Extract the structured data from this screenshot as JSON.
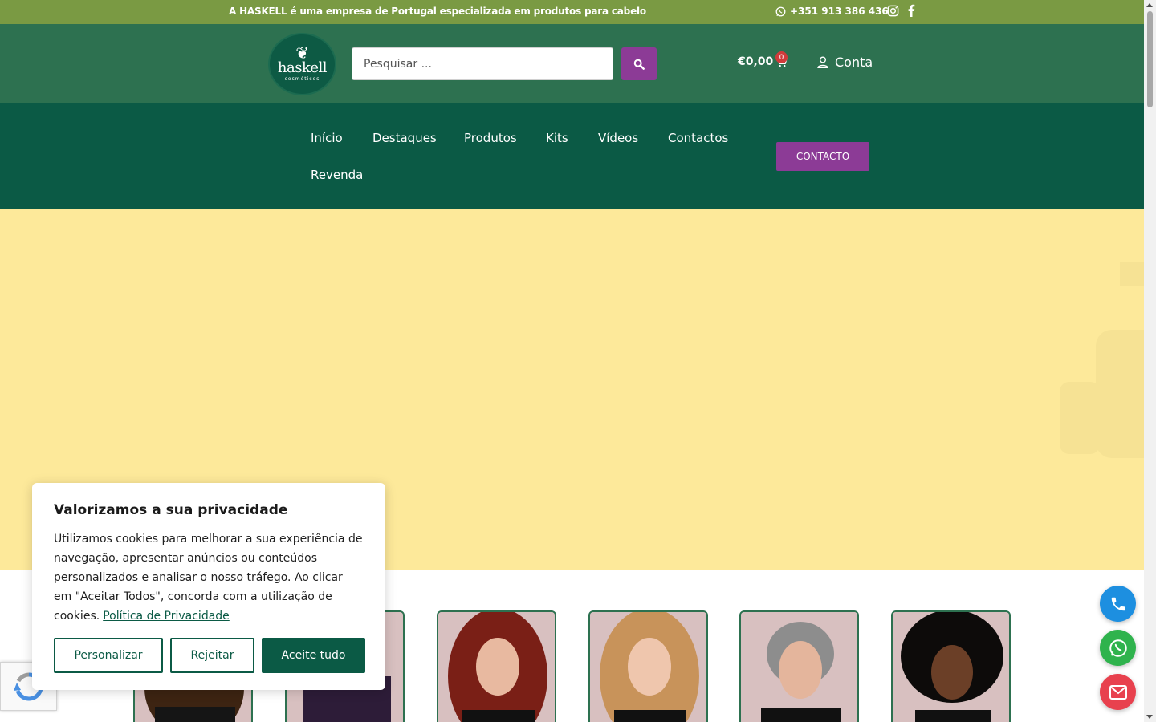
{
  "topbar": {
    "message": "A HASKELL é uma empresa de Portugal especializada em produtos para cabelo",
    "phone": "+351 913 386 436",
    "icons": [
      "whatsapp-icon",
      "instagram-icon",
      "facebook-icon"
    ]
  },
  "header": {
    "logo": {
      "name": "haskell",
      "subtitle": "cosméticos"
    },
    "search": {
      "placeholder": "Pesquisar ..."
    },
    "cart": {
      "total": "€0,00",
      "count": "0"
    },
    "account_label": "Conta"
  },
  "nav": {
    "items": [
      "Início",
      "Destaques",
      "Produtos",
      "Kits",
      "Vídeos",
      "Contactos",
      "Revenda"
    ],
    "cta_label": "CONTACTO"
  },
  "cookie_banner": {
    "title": "Valorizamos a sua privacidade",
    "body": "Utilizamos cookies para melhorar a sua experiência de navegação, apresentar anúncios ou conteúdos personalizados e analisar o nosso tráfego. Ao clicar em \"Aceitar Todos\", concorda com a utilização de cookies.",
    "policy_link": "Política de Privacidade",
    "buttons": {
      "customize": "Personalizar",
      "reject": "Rejeitar",
      "accept": "Aceite tudo"
    }
  },
  "colors": {
    "topbar": "#7a9a43",
    "header": "#2d7150",
    "nav": "#0b5a45",
    "accent_purple": "#8c3b96",
    "hero": "#fde99a",
    "card_bg": "#d8c0c0"
  },
  "floating_actions": [
    "phone-icon",
    "whatsapp-icon",
    "mail-icon"
  ]
}
